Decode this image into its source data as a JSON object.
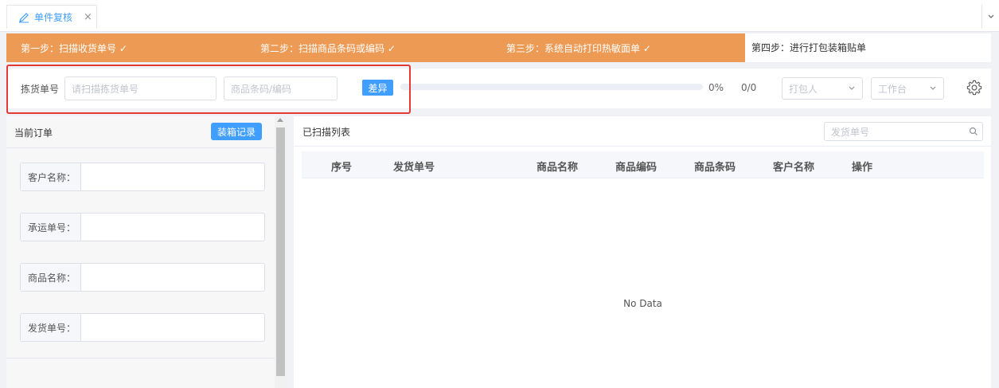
{
  "tab": {
    "title": "单件复核",
    "close": "×"
  },
  "steps": [
    {
      "label": "第一步：扫描收货单号 ✓"
    },
    {
      "label": "第二步：扫描商品条码或编码 ✓"
    },
    {
      "label": "第三步：系统自动打印热敏面单 ✓"
    },
    {
      "label": "第四步：进行打包装箱贴单"
    }
  ],
  "toolbar": {
    "pick_label": "拣货单号",
    "pick_placeholder": "请扫描拣货单号",
    "sku_placeholder": "商品条码/编码",
    "diff_button": "差异",
    "progress_percent": 0,
    "percent_text": "0%",
    "count_text": "0/0",
    "packer_placeholder": "打包人",
    "station_placeholder": "工作台",
    "settings_icon": "gear-icon"
  },
  "current_order": {
    "title": "当前订单",
    "pack_record_button": "装箱记录",
    "fields": [
      {
        "label": "客户名称：",
        "value": ""
      },
      {
        "label": "承运单号：",
        "value": ""
      },
      {
        "label": "商品名称：",
        "value": ""
      },
      {
        "label": "发货单号：",
        "value": ""
      }
    ]
  },
  "scanned": {
    "title": "已扫描列表",
    "search_placeholder": "发货单号",
    "columns": [
      "序号",
      "发货单号",
      "商品名称",
      "商品编码",
      "商品条码",
      "客户名称",
      "操作"
    ],
    "empty_text": "No Data"
  },
  "colors": {
    "step_done": "#ed9a55",
    "primary": "#409eff",
    "highlight": "#e53935"
  }
}
